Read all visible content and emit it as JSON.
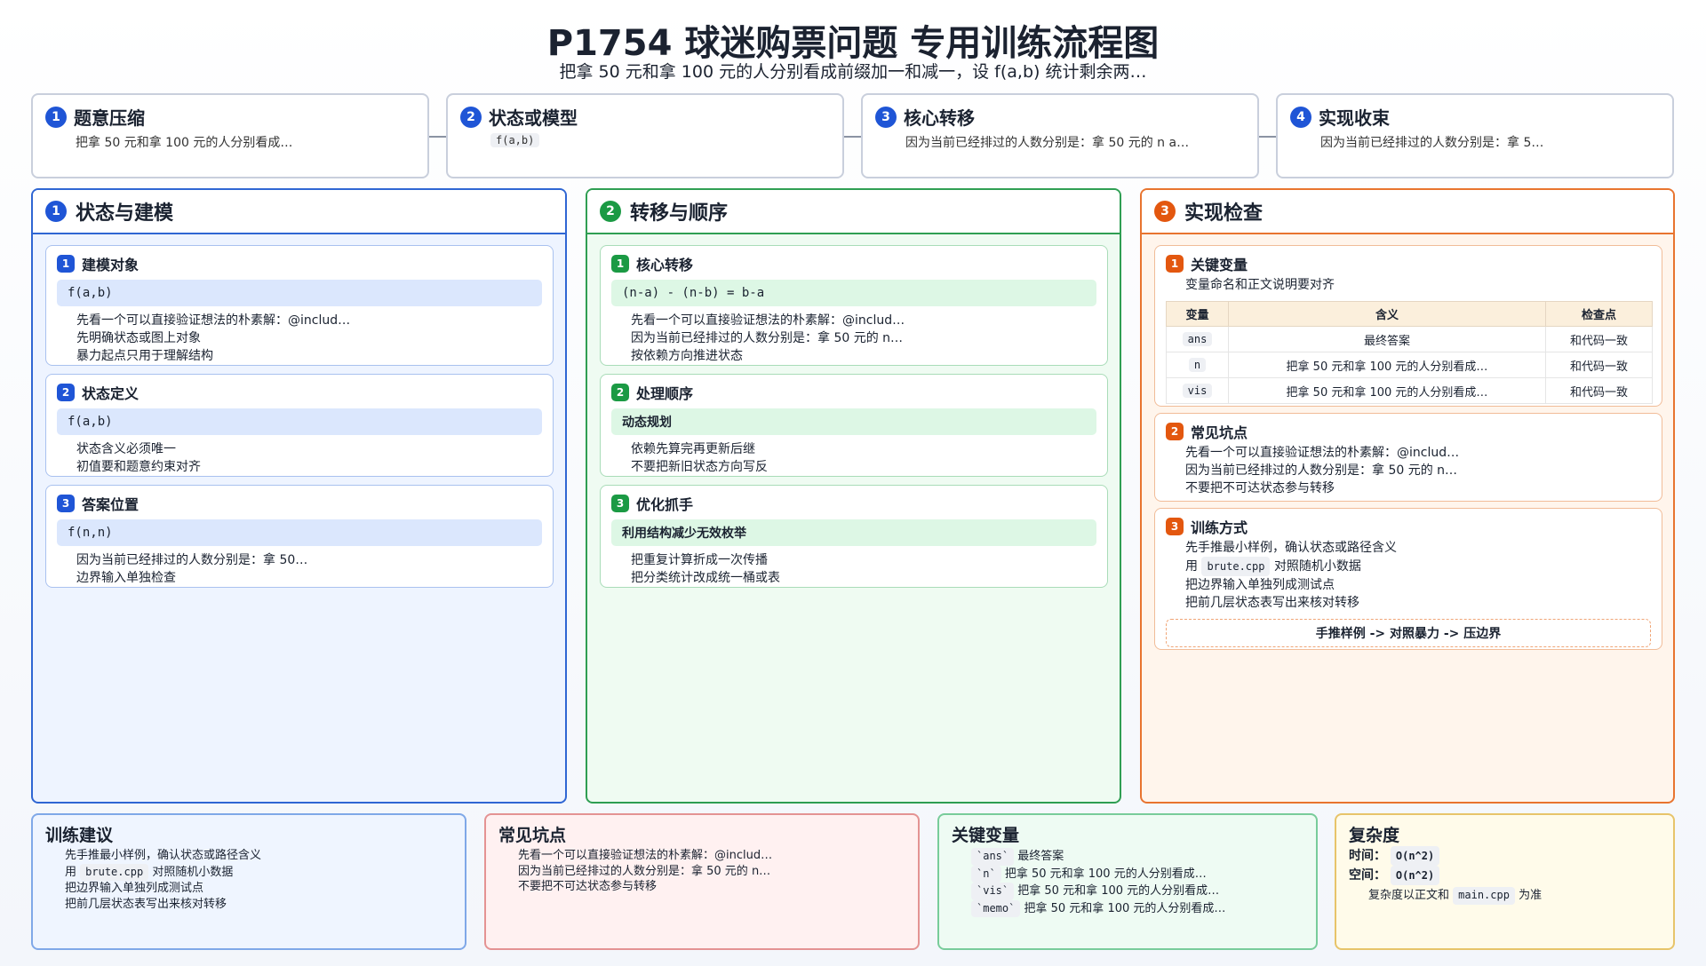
{
  "header": {
    "title": "P1754 球迷购票问题 专用训练流程图",
    "subtitle": "把拿 50 元和拿 100 元的人分别看成前缀加一和减一，设 f(a,b) 统计剩余两…"
  },
  "flow": [
    {
      "n": "1",
      "title": "题意压缩",
      "desc": "把拿 50 元和拿 100 元的人分别看成…"
    },
    {
      "n": "2",
      "title": "状态或模型",
      "code": "f(a,b)"
    },
    {
      "n": "3",
      "title": "核心转移",
      "desc": "因为当前已经排过的人数分别是：拿 50 元的 n a…"
    },
    {
      "n": "4",
      "title": "实现收束",
      "desc": "因为当前已经排过的人数分别是：拿 5…"
    }
  ],
  "columns": {
    "model": {
      "n": "1",
      "title": "状态与建模",
      "cards": [
        {
          "n": "1",
          "title": "建模对象",
          "code": "f(a,b)",
          "items": [
            "先看一个可以直接验证想法的朴素解：@includ…",
            "先明确状态或图上对象",
            "暴力起点只用于理解结构"
          ]
        },
        {
          "n": "2",
          "title": "状态定义",
          "code": "f(a,b)",
          "items": [
            "状态含义必须唯一",
            "初值要和题意约束对齐"
          ]
        },
        {
          "n": "3",
          "title": "答案位置",
          "code": "f(n,n)",
          "items": [
            "因为当前已经排过的人数分别是：拿 50…",
            "边界输入单独检查"
          ]
        }
      ]
    },
    "transition": {
      "n": "2",
      "title": "转移与顺序",
      "cards": [
        {
          "n": "1",
          "title": "核心转移",
          "code": "(n-a) - (n-b) = b-a",
          "items": [
            "先看一个可以直接验证想法的朴素解：@includ…",
            "因为当前已经排过的人数分别是：拿 50 元的 n…",
            "按依赖方向推进状态"
          ]
        },
        {
          "n": "2",
          "title": "处理顺序",
          "bar": "动态规划",
          "items": [
            "依赖先算完再更新后继",
            "不要把新旧状态方向写反"
          ]
        },
        {
          "n": "3",
          "title": "优化抓手",
          "bar": "利用结构减少无效枚举",
          "items": [
            "把重复计算折成一次传播",
            "把分类统计改成统一桶或表"
          ]
        }
      ]
    },
    "check": {
      "n": "3",
      "title": "实现检查",
      "vars": {
        "n": "1",
        "title": "关键变量",
        "note": "变量命名和正文说明要对齐",
        "headers": [
          "变量",
          "含义",
          "检查点"
        ],
        "rows": [
          [
            "ans",
            "最终答案",
            "和代码一致"
          ],
          [
            "n",
            "把拿 50 元和拿 100 元的人分别看成…",
            "和代码一致"
          ],
          [
            "vis",
            "把拿 50 元和拿 100 元的人分别看成…",
            "和代码一致"
          ]
        ]
      },
      "pitfalls": {
        "n": "2",
        "title": "常见坑点",
        "items": [
          "先看一个可以直接验证想法的朴素解：@includ…",
          "因为当前已经排过的人数分别是：拿 50 元的 n…",
          "不要把不可达状态参与转移"
        ]
      },
      "training": {
        "n": "3",
        "title": "训练方式",
        "items": [
          "先手推最小样例，确认状态或路径含义",
          "把边界输入单独列成测试点",
          "把前几层状态表写出来核对转移"
        ],
        "brute_pre": "用",
        "brute_code": "brute.cpp",
        "brute_post": "对照随机小数据",
        "flow_text": "手推样例 -> 对照暴力 -> 压边界"
      }
    }
  },
  "bottom": {
    "advice": {
      "title": "训练建议",
      "item1": "先手推最小样例，确认状态或路径含义",
      "item2_pre": "用",
      "item2_code": "brute.cpp",
      "item2_post": "对照随机小数据",
      "item3": "把边界输入单独列成测试点",
      "item4": "把前几层状态表写出来核对转移"
    },
    "pitfalls": {
      "title": "常见坑点",
      "items": [
        "先看一个可以直接验证想法的朴素解：@includ…",
        "因为当前已经排过的人数分别是：拿 50 元的 n…",
        "不要把不可达状态参与转移"
      ]
    },
    "vars": {
      "title": "关键变量",
      "items": [
        {
          "code": "`ans`",
          "text": "最终答案"
        },
        {
          "code": "`n`",
          "text": "把拿 50 元和拿 100 元的人分别看成…"
        },
        {
          "code": "`vis`",
          "text": "把拿 50 元和拿 100 元的人分别看成…"
        },
        {
          "code": "`memo`",
          "text": "把拿 50 元和拿 100 元的人分别看成…"
        }
      ]
    },
    "complexity": {
      "title": "复杂度",
      "time_label": "时间：",
      "time": "O(n^2)",
      "space_label": "空间：",
      "space": "O(n^2)",
      "note_pre": "复杂度以正文和",
      "note_code": "main.cpp",
      "note_post": "为准"
    }
  }
}
